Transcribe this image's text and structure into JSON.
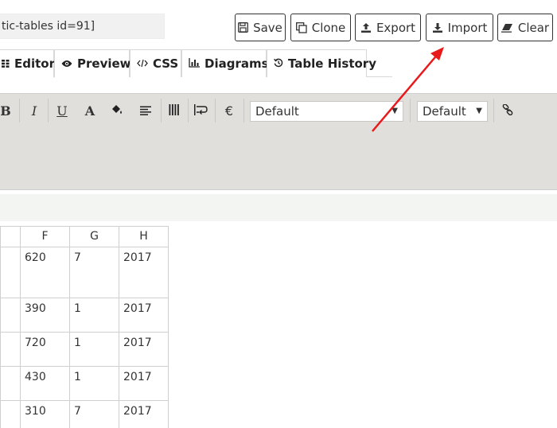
{
  "shortcode": "tic-tables id=91]",
  "actions": [
    {
      "key": "save",
      "label": "Save",
      "icon": "save-icon"
    },
    {
      "key": "clone",
      "label": "Clone",
      "icon": "clone-icon"
    },
    {
      "key": "export",
      "label": "Export",
      "icon": "export-icon"
    },
    {
      "key": "import",
      "label": "Import",
      "icon": "import-icon"
    },
    {
      "key": "clear",
      "label": "Clear",
      "icon": "eraser-icon"
    }
  ],
  "tabs": [
    {
      "key": "editor",
      "label": "Editor",
      "icon": "grid-icon",
      "active": true
    },
    {
      "key": "preview",
      "label": "Preview",
      "icon": "eye-icon"
    },
    {
      "key": "css",
      "label": "CSS",
      "icon": "code-icon"
    },
    {
      "key": "diagrams",
      "label": "Diagrams",
      "icon": "chart-icon"
    },
    {
      "key": "history",
      "label": "Table History",
      "icon": "history-icon"
    }
  ],
  "toolbar": {
    "bold": "B",
    "italic": "I",
    "underline": "U",
    "text_color": "A",
    "currency": "€",
    "font_select": "Default",
    "size_select": "Default"
  },
  "grid": {
    "columns": [
      "F",
      "G",
      "H"
    ],
    "rows": [
      [
        "620",
        "7",
        "2017"
      ],
      [
        "390",
        "1",
        "2017"
      ],
      [
        "720",
        "1",
        "2017"
      ],
      [
        "430",
        "1",
        "2017"
      ],
      [
        "310",
        "7",
        "2017"
      ]
    ]
  },
  "annotation": {
    "color": "#e8191b",
    "target": "import-button"
  }
}
